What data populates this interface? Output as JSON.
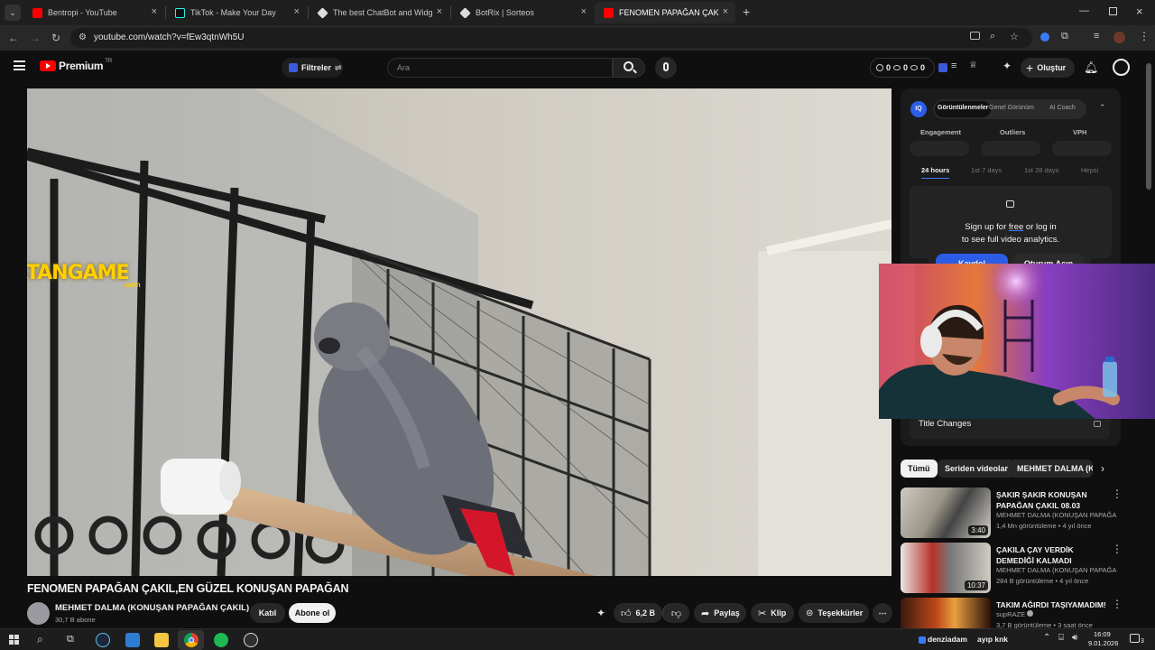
{
  "browser": {
    "tabs": [
      {
        "title": "Bentropi - YouTube",
        "color": "#ff0000",
        "active": false
      },
      {
        "title": "TikTok - Make Your Day",
        "color": "#111111",
        "active": false
      },
      {
        "title": "The best ChatBot and Widgets",
        "color": "#dddddd",
        "active": false
      },
      {
        "title": "BotRix | Sorteos",
        "color": "#dddddd",
        "active": false
      },
      {
        "title": "FENOMEN PAPAĞAN ÇAKIL,EN",
        "color": "#ff0000",
        "active": true
      }
    ],
    "url": "youtube.com/watch?v=fEw3qtnWh5U"
  },
  "masthead": {
    "logo": "Premium",
    "region": "TR",
    "filters_label": "Filtreler",
    "search_placeholder": "Ara",
    "stats": [
      "0",
      "0",
      "0"
    ],
    "create_label": "Oluştur"
  },
  "video": {
    "title": "FENOMEN PAPAĞAN ÇAKIL,EN GÜZEL KONUŞAN PAPAĞAN",
    "channel": "MEHMET DALMA (KONUŞAN PAPAĞAN ÇAKIL)",
    "subscribers": "30,7 B abone",
    "join_label": "Katıl",
    "subscribe_label": "Abone ol",
    "likes": "6,2 B",
    "share_label": "Paylaş",
    "clip_label": "Klip",
    "thanks_label": "Teşekkürler",
    "overlay_logo": "VATANGAME",
    "overlay_logo_sub": ".com"
  },
  "analytics": {
    "tabs": [
      "Görüntülenmeler",
      "Genel Görünüm",
      "AI Coach"
    ],
    "metrics": [
      "Engagement",
      "Outliers",
      "VPH"
    ],
    "ranges": [
      "24 hours",
      "1st 7 days",
      "1st 28 days",
      "Hepsi"
    ],
    "signup_line1_pre": "Sign up for ",
    "signup_free": "free",
    "signup_line1_post": " or log in",
    "signup_line2": "to see full video analytics.",
    "register_label": "Kaydol",
    "login_label": "Oturum Açın",
    "title_changes": "Title Changes"
  },
  "chips": [
    "Tümü",
    "Seriden videolar",
    "MEHMET DALMA (KO"
  ],
  "recommendations": [
    {
      "title": "ŞAKIR ŞAKIR KONUŞAN PAPAĞAN ÇAKIL 08.03",
      "channel": "MEHMET DALMA (KONUŞAN PAPAĞAN ...",
      "meta": "1,4 Mn görüntüleme • 4 yıl önce",
      "duration": "3:40"
    },
    {
      "title": "ÇAKILA ÇAY VERDİK DEMEDİĞİ KALMADI",
      "channel": "MEHMET DALMA (KONUŞAN PAPAĞAN ...",
      "meta": "284 B görüntüleme • 4 yıl önce",
      "duration": "10:37"
    },
    {
      "title": "TAKIM AĞIRDI TAŞIYAMADIM!",
      "channel": "supRAZE",
      "meta": "3,7 B görüntüleme • 3 saat önce",
      "duration": ""
    }
  ],
  "taskbar": {
    "user": "denziadam",
    "user_extra": "ayıp knk",
    "time": "16:09",
    "date": "9.01.2026",
    "notifications": "3"
  }
}
